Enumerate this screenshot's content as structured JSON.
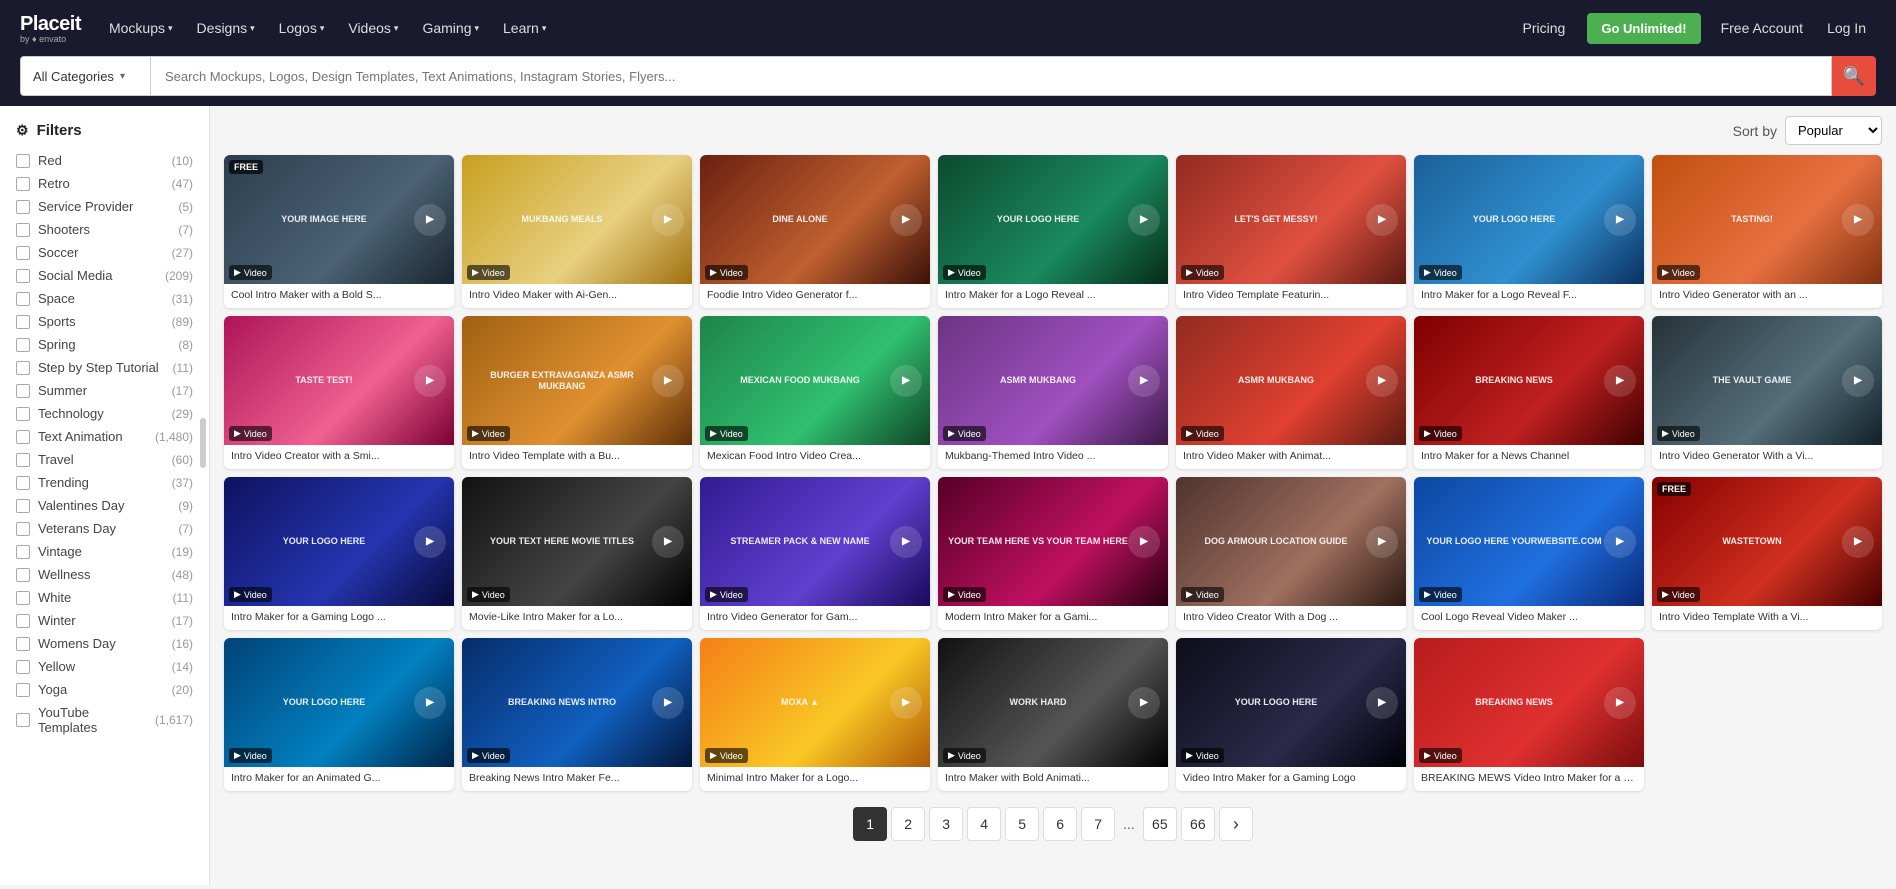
{
  "nav": {
    "logo": "Placeit",
    "logo_sub": "by ♦ envato",
    "links": [
      {
        "label": "Mockups",
        "id": "mockups"
      },
      {
        "label": "Designs",
        "id": "designs"
      },
      {
        "label": "Logos",
        "id": "logos"
      },
      {
        "label": "Videos",
        "id": "videos"
      },
      {
        "label": "Gaming",
        "id": "gaming"
      },
      {
        "label": "Learn",
        "id": "learn"
      }
    ],
    "pricing": "Pricing",
    "go_unlimited": "Go Unlimited!",
    "free_account": "Free Account",
    "login": "Log In"
  },
  "search": {
    "category": "All Categories",
    "placeholder": "Search Mockups, Logos, Design Templates, Text Animations, Instagram Stories, Flyers..."
  },
  "filters": {
    "title": "Filters",
    "items": [
      {
        "label": "Red",
        "count": "(10)"
      },
      {
        "label": "Retro",
        "count": "(47)"
      },
      {
        "label": "Service Provider",
        "count": "(5)"
      },
      {
        "label": "Shooters",
        "count": "(7)"
      },
      {
        "label": "Soccer",
        "count": "(27)"
      },
      {
        "label": "Social Media",
        "count": "(209)"
      },
      {
        "label": "Space",
        "count": "(31)"
      },
      {
        "label": "Sports",
        "count": "(89)"
      },
      {
        "label": "Spring",
        "count": "(8)"
      },
      {
        "label": "Step by Step Tutorial",
        "count": "(11)"
      },
      {
        "label": "Summer",
        "count": "(17)"
      },
      {
        "label": "Technology",
        "count": "(29)"
      },
      {
        "label": "Text Animation",
        "count": "(1,480)"
      },
      {
        "label": "Travel",
        "count": "(60)"
      },
      {
        "label": "Trending",
        "count": "(37)"
      },
      {
        "label": "Valentines Day",
        "count": "(9)"
      },
      {
        "label": "Veterans Day",
        "count": "(7)"
      },
      {
        "label": "Vintage",
        "count": "(19)"
      },
      {
        "label": "Wellness",
        "count": "(48)"
      },
      {
        "label": "White",
        "count": "(11)"
      },
      {
        "label": "Winter",
        "count": "(17)"
      },
      {
        "label": "Womens Day",
        "count": "(16)"
      },
      {
        "label": "Yellow",
        "count": "(14)"
      },
      {
        "label": "Yoga",
        "count": "(20)"
      },
      {
        "label": "YouTube Templates",
        "count": "(1,617)"
      }
    ]
  },
  "sort": {
    "label": "Sort by",
    "value": "Popular"
  },
  "cards": [
    {
      "title": "Cool Intro Maker with a Bold S...",
      "bg": "#2c3e50",
      "text": "YOUR IMAGE HERE",
      "free": true,
      "color1": "#2c3e50",
      "color2": "#1a252f"
    },
    {
      "title": "Intro Video Maker with Ai-Gen...",
      "bg": "#e8c97a",
      "text": "Mukbang Meals",
      "free": false,
      "color1": "#e8c97a",
      "color2": "#d4a853"
    },
    {
      "title": "Foodie Intro Video Generator f...",
      "bg": "#8b4513",
      "text": "DINE ALONE",
      "free": false,
      "color1": "#6b3410",
      "color2": "#8b4513"
    },
    {
      "title": "Intro Maker for a Logo Reveal ...",
      "bg": "#1a6b4a",
      "text": "YOUR LOGO HERE",
      "free": false,
      "color1": "#1a6b4a",
      "color2": "#0d4a30"
    },
    {
      "title": "Intro Video Template Featurin...",
      "bg": "#c0392b",
      "text": "LET'S GET MESSY!",
      "free": false,
      "color1": "#c0392b",
      "color2": "#922b21"
    },
    {
      "title": "Intro Maker for a Logo Reveal F...",
      "bg": "#2980b9",
      "text": "YOUR LOGO HERE",
      "free": false,
      "color1": "#2980b9",
      "color2": "#1a6090"
    },
    {
      "title": "Intro Video Generator with an ...",
      "bg": "#e67e22",
      "text": "TASTING!",
      "free": false,
      "color1": "#e67e22",
      "color2": "#ca6f1e"
    },
    {
      "title": "Intro Video Creator with a Smi...",
      "bg": "#e91e63",
      "text": "TASTE TEST!",
      "free": false,
      "color1": "#ad1457",
      "color2": "#e91e63"
    },
    {
      "title": "Intro Video Template with a Bu...",
      "bg": "#f39c12",
      "text": "BURGER EXTRAVAGANZA ASMR MUKBANG",
      "free": false,
      "color1": "#d68910",
      "color2": "#f39c12"
    },
    {
      "title": "Mexican Food Intro Video Crea...",
      "bg": "#27ae60",
      "text": "MEXICAN FOOD MUKBANG",
      "free": false,
      "color1": "#1e8449",
      "color2": "#27ae60"
    },
    {
      "title": "Mukbang-Themed Intro Video ...",
      "bg": "#8e44ad",
      "text": "ASMR MUKBANG",
      "free": false,
      "color1": "#6c3483",
      "color2": "#8e44ad"
    },
    {
      "title": "Intro Video Maker with Animat...",
      "bg": "#c0392b",
      "text": "ASMR MUKBANG",
      "free": false,
      "color1": "#922b21",
      "color2": "#c0392b"
    },
    {
      "title": "Intro Maker for a News Channel",
      "bg": "#b71c1c",
      "text": "BREAKING NEWS",
      "free": false,
      "color1": "#7f0000",
      "color2": "#b71c1c"
    },
    {
      "title": "Intro Video Generator With a Vi...",
      "bg": "#37474f",
      "text": "THE VAULT GAME",
      "free": false,
      "color1": "#263238",
      "color2": "#37474f"
    },
    {
      "title": "Intro Maker for a Gaming Logo ...",
      "bg": "#1a237e",
      "text": "YOUR LOGO HERE",
      "free": false,
      "color1": "#0d1260",
      "color2": "#1a237e"
    },
    {
      "title": "Movie-Like Intro Maker for a Lo...",
      "bg": "#212121",
      "text": "YOUR TEXT HERE MOVIE TITLES",
      "free": false,
      "color1": "#111",
      "color2": "#333"
    },
    {
      "title": "Intro Video Generator for Gam...",
      "bg": "#4a148c",
      "text": "STREAMER PACK & NEW NAME",
      "free": false,
      "color1": "#311b92",
      "color2": "#4a148c"
    },
    {
      "title": "Modern Intro Maker for a Gami...",
      "bg": "#880e4f",
      "text": "YOUR TEAM HERE VS YOUR TEAM HERE",
      "free": false,
      "color1": "#560027",
      "color2": "#880e4f"
    },
    {
      "title": "Intro Video Creator With a Dog ...",
      "bg": "#795548",
      "text": "DOG ARMOUR LOCATION GUIDE",
      "free": false,
      "color1": "#4e342e",
      "color2": "#795548"
    },
    {
      "title": "Cool Logo Reveal Video Maker ...",
      "bg": "#1565c0",
      "text": "YOUR LOGO HERE yourwebsite.com",
      "free": false,
      "color1": "#0d47a1",
      "color2": "#1565c0"
    },
    {
      "title": "Intro Video Template With a Vi...",
      "bg": "#bf360c",
      "text": "WASTETOWN",
      "free": true,
      "color1": "#870000",
      "color2": "#bf360c"
    },
    {
      "title": "Intro Maker for an Animated G...",
      "bg": "#01579b",
      "text": "YOUR LOGO HERE",
      "free": false,
      "color1": "#014377",
      "color2": "#01579b"
    },
    {
      "title": "Breaking News Intro Maker Fe...",
      "bg": "#0d47a1",
      "text": "BREAKING NEWS INTRO",
      "free": false,
      "color1": "#082c6a",
      "color2": "#0d47a1"
    },
    {
      "title": "Minimal Intro Maker for a Logo...",
      "bg": "#f9a825",
      "text": "MOXA ▲",
      "free": false,
      "color1": "#f57f17",
      "color2": "#f9a825"
    },
    {
      "title": "Intro Maker with Bold Animati...",
      "bg": "#212121",
      "text": "WORK HARD",
      "free": false,
      "color1": "#111",
      "color2": "#333"
    },
    {
      "title": "Video Intro Maker for a Gaming Logo",
      "bg": "#1a1a2e",
      "text": "YOUR LOGO HERE",
      "free": false,
      "color1": "#1a1a2e",
      "color2": "#0d0d1a"
    },
    {
      "title": "BREAKING MEWS Video Intro Maker for a News Channel",
      "bg": "#c62828",
      "text": "BREAKING NEWS",
      "free": false,
      "color1": "#b71c1c",
      "color2": "#c62828"
    }
  ],
  "pagination": {
    "pages": [
      "1",
      "2",
      "3",
      "4",
      "5",
      "6",
      "7",
      "65",
      "66"
    ],
    "active": "1",
    "ellipsis": "...",
    "next": "›"
  }
}
